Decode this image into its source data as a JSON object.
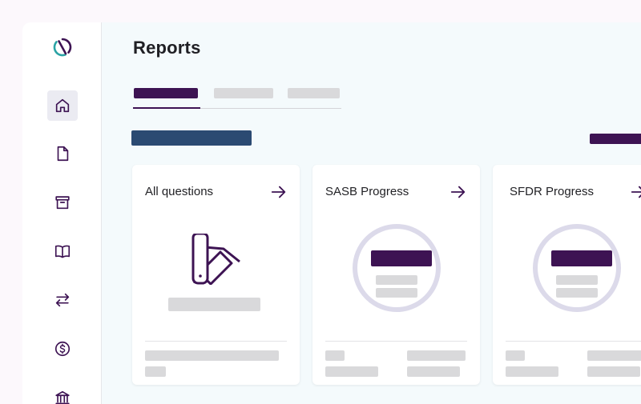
{
  "page": {
    "title": "Reports"
  },
  "sidebar": {
    "items": [
      {
        "icon": "home-icon",
        "active": true
      },
      {
        "icon": "document-icon"
      },
      {
        "icon": "archive-icon"
      },
      {
        "icon": "book-icon"
      },
      {
        "icon": "transfer-icon"
      },
      {
        "icon": "dollar-icon"
      },
      {
        "icon": "bank-icon"
      }
    ]
  },
  "cards": [
    {
      "title": "All questions"
    },
    {
      "title": "SASB Progress"
    },
    {
      "title": "SFDR Progress"
    }
  ],
  "colors": {
    "brand": "#3d1353",
    "accent_blue": "#2b4a72",
    "logo_teal": "#2ba3a5",
    "ring": "#dcdaea",
    "skeleton": "#d9d9db",
    "background": "#f4fafc"
  }
}
